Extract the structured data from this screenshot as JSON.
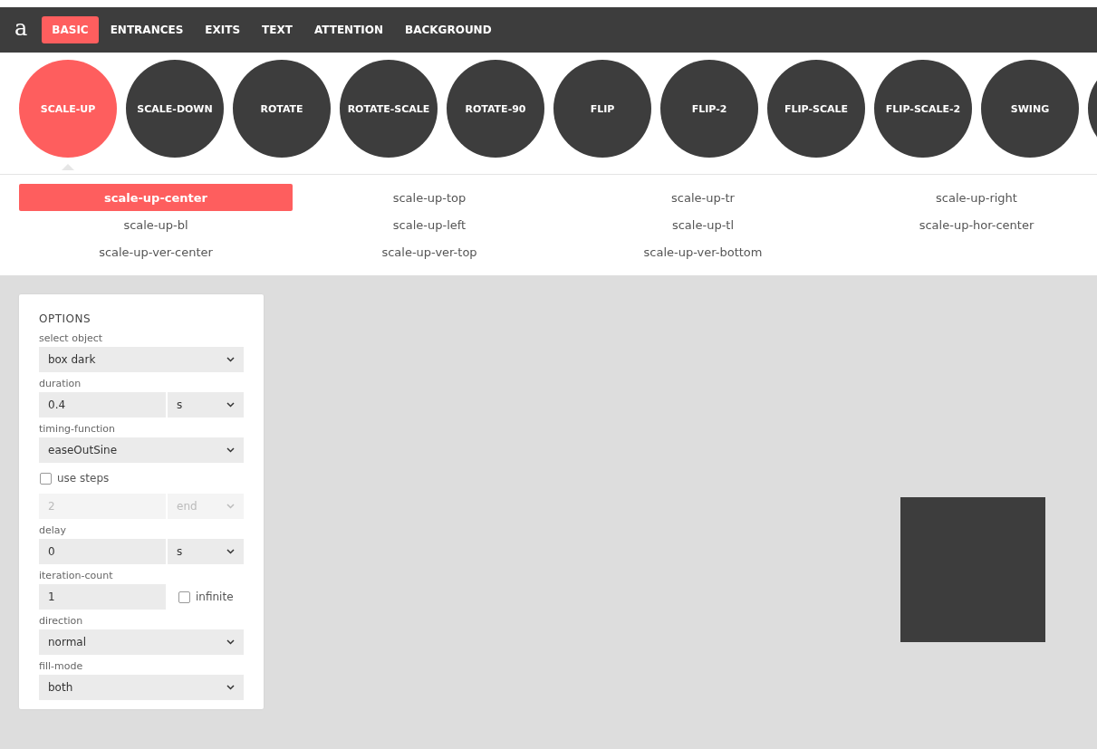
{
  "logo": "a",
  "nav": [
    {
      "label": "BASIC",
      "selected": true
    },
    {
      "label": "ENTRANCES",
      "selected": false
    },
    {
      "label": "EXITS",
      "selected": false
    },
    {
      "label": "TEXT",
      "selected": false
    },
    {
      "label": "ATTENTION",
      "selected": false
    },
    {
      "label": "BACKGROUND",
      "selected": false
    }
  ],
  "animations": [
    {
      "label": "SCALE-UP",
      "selected": true
    },
    {
      "label": "SCALE-DOWN",
      "selected": false
    },
    {
      "label": "ROTATE",
      "selected": false
    },
    {
      "label": "ROTATE-SCALE",
      "selected": false
    },
    {
      "label": "ROTATE-90",
      "selected": false
    },
    {
      "label": "FLIP",
      "selected": false
    },
    {
      "label": "FLIP-2",
      "selected": false
    },
    {
      "label": "FLIP-SCALE",
      "selected": false
    },
    {
      "label": "FLIP-SCALE-2",
      "selected": false
    },
    {
      "label": "SWING",
      "selected": false
    }
  ],
  "variants": [
    {
      "label": "scale-up-center",
      "selected": true
    },
    {
      "label": "scale-up-top",
      "selected": false
    },
    {
      "label": "scale-up-tr",
      "selected": false
    },
    {
      "label": "scale-up-right",
      "selected": false
    },
    {
      "label": "scale-up-bl",
      "selected": false
    },
    {
      "label": "scale-up-left",
      "selected": false
    },
    {
      "label": "scale-up-tl",
      "selected": false
    },
    {
      "label": "scale-up-hor-center",
      "selected": false
    },
    {
      "label": "scale-up-ver-center",
      "selected": false
    },
    {
      "label": "scale-up-ver-top",
      "selected": false
    },
    {
      "label": "scale-up-ver-bottom",
      "selected": false
    }
  ],
  "options": {
    "title": "OPTIONS",
    "fields": [
      {
        "kind": "select",
        "label": "select object",
        "value": "box dark"
      },
      {
        "kind": "split",
        "label": "duration",
        "value": "0.4",
        "unit": "s",
        "disabled": false
      },
      {
        "kind": "select",
        "label": "timing-function",
        "value": "easeOutSine"
      },
      {
        "kind": "checkbox",
        "label": "use steps",
        "checked": false
      },
      {
        "kind": "split",
        "placeholder": "2",
        "unit": "end",
        "disabled": true
      },
      {
        "kind": "split",
        "label": "delay",
        "value": "0",
        "unit": "s",
        "disabled": false
      },
      {
        "kind": "count",
        "label": "iteration-count",
        "value": "1",
        "check_label": "infinite",
        "checked": false
      },
      {
        "kind": "select",
        "label": "direction",
        "value": "normal"
      },
      {
        "kind": "select",
        "label": "fill-mode",
        "value": "both"
      }
    ]
  }
}
